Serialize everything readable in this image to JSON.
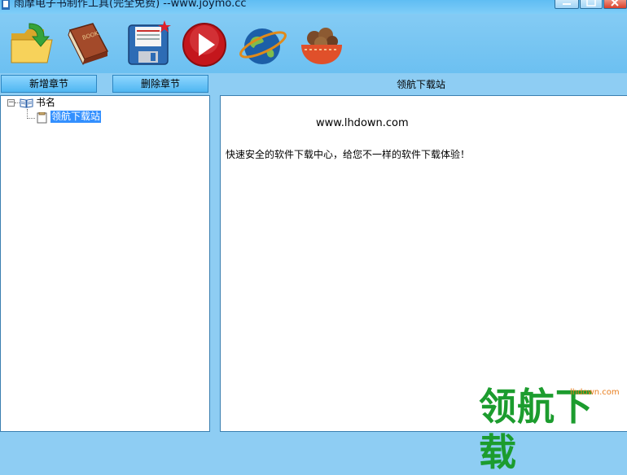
{
  "window": {
    "title": "雨摩电子书制作工具(完全免费) --www.joymo.cc"
  },
  "toolbar": {
    "items": [
      {
        "icon": "open-folder-icon"
      },
      {
        "icon": "book-icon"
      },
      {
        "icon": "save-disk-icon"
      },
      {
        "icon": "play-icon"
      },
      {
        "icon": "globe-icon"
      },
      {
        "icon": "food-bowl-icon"
      }
    ]
  },
  "actions": {
    "add_chapter": "新增章节",
    "delete_chapter": "删除章节"
  },
  "tree": {
    "toggle": "−",
    "root_label": "书名",
    "chapters": [
      {
        "label": "领航下载站",
        "selected": true
      }
    ]
  },
  "editor": {
    "title": "领航下载站",
    "url_line": "www.lhdown.com",
    "body_text": "快速安全的软件下载中心，给您不一样的软件下载体验！"
  },
  "watermark": {
    "text": "领航下载",
    "url": "lhdown.com"
  },
  "colors": {
    "background": "#8ecdf3",
    "button": "#4fb6f1",
    "selection": "#3390ff",
    "watermark": "#1c9c2e"
  }
}
